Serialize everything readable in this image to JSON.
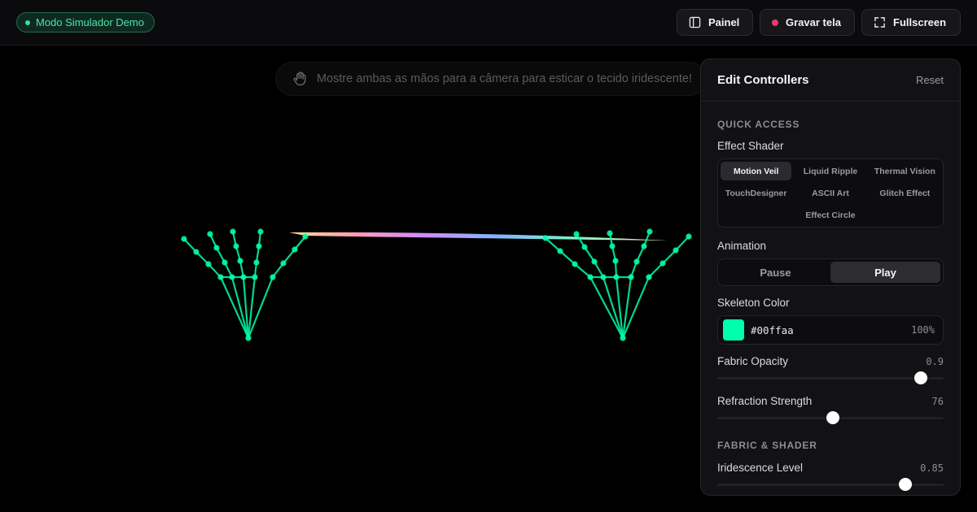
{
  "topbar": {
    "demo_badge": "Modo Simulador Demo",
    "panel_button": "Painel",
    "record_button": "Gravar tela",
    "fullscreen_button": "Fullscreen",
    "icons": {
      "panel": "sidebar-icon",
      "record": "record-dot-icon",
      "fullscreen": "expand-icon"
    },
    "colors": {
      "badge_green": "#4fe3a8",
      "record_red": "#ec3b6a"
    }
  },
  "hint": {
    "text": "Mostre ambas as mãos para a câmera para esticar o tecido iridescente!",
    "icon": "hand-icon"
  },
  "scene": {
    "skeleton_color": "#00ffaa",
    "hands": 2
  },
  "panel": {
    "title": "Edit Controllers",
    "reset": "Reset",
    "quick_access": "QUICK ACCESS",
    "effect_shader": {
      "label": "Effect Shader",
      "options": [
        "Motion Veil",
        "Liquid Ripple",
        "Thermal Vision",
        "TouchDesigner",
        "ASCII Art",
        "Glitch Effect",
        "Effect Circle"
      ],
      "selected": "Motion Veil"
    },
    "animation": {
      "label": "Animation",
      "options": [
        "Pause",
        "Play"
      ],
      "selected": "Play"
    },
    "skeleton_color": {
      "label": "Skeleton Color",
      "hex": "#00ffaa",
      "opacity": "100%"
    },
    "fabric_opacity": {
      "label": "Fabric Opacity",
      "value": "0.9",
      "fraction": 0.9
    },
    "refraction_strength": {
      "label": "Refraction Strength",
      "value": "76",
      "fraction": 0.51
    },
    "fabric_shader": "FABRIC & SHADER",
    "iridescence_level": {
      "label": "Iridescence Level",
      "value": "0.85",
      "fraction": 0.83
    }
  }
}
